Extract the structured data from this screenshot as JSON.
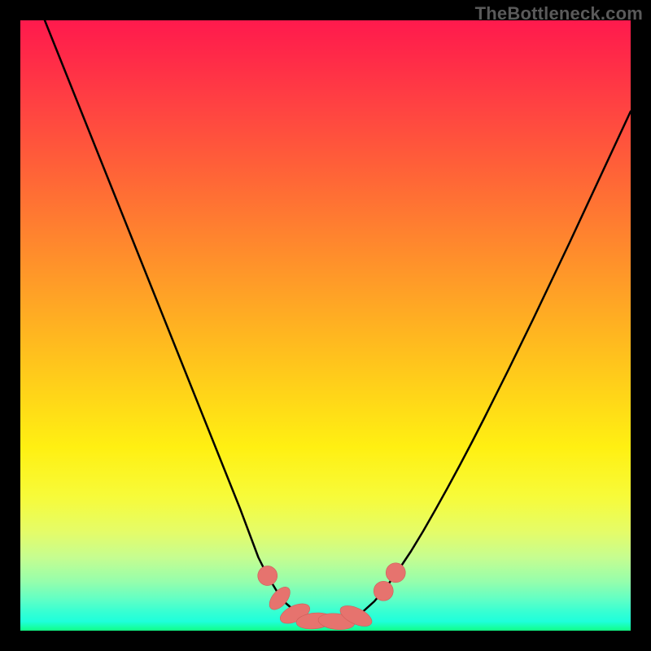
{
  "attribution": "TheBottleneck.com",
  "colors": {
    "curve_stroke": "#000000",
    "bead_fill": "#e6736e",
    "bead_stroke": "#cc5e59"
  },
  "chart_data": {
    "type": "line",
    "title": "",
    "xlabel": "",
    "ylabel": "",
    "xlim": [
      0,
      100
    ],
    "ylim": [
      0,
      100
    ],
    "grid": false,
    "legend": null,
    "series": [
      {
        "name": "curve",
        "x": [
          4,
          6,
          8,
          10,
          12,
          14,
          16,
          18,
          20,
          22,
          24,
          26,
          28,
          30,
          32,
          34,
          36,
          37.5,
          39,
          40.5,
          42,
          43.5,
          45,
          46.5,
          48,
          49.5,
          51,
          52.5,
          54,
          56,
          58,
          60,
          62,
          64,
          66,
          68,
          70,
          72,
          74,
          76,
          78,
          80,
          82,
          84,
          86,
          88,
          90,
          92,
          94,
          96,
          98,
          100
        ],
        "y": [
          100,
          95,
          90,
          85,
          80,
          75,
          70,
          65,
          60,
          55,
          50,
          45,
          40,
          35,
          30,
          25,
          20,
          16,
          12,
          9,
          6.5,
          4.5,
          3.2,
          2.3,
          1.7,
          1.4,
          1.3,
          1.5,
          1.9,
          3.0,
          4.8,
          7.2,
          10.0,
          13.0,
          16.3,
          19.8,
          23.4,
          27.1,
          30.9,
          34.8,
          38.8,
          42.8,
          46.9,
          51.0,
          55.2,
          59.4,
          63.6,
          67.9,
          72.2,
          76.5,
          80.8,
          85.1
        ]
      }
    ],
    "markers": [
      {
        "cx": 40.5,
        "cy": 9.0,
        "rx": 1.6,
        "ry": 1.6,
        "angle": -55
      },
      {
        "cx": 42.5,
        "cy": 5.3,
        "rx": 2.2,
        "ry": 1.2,
        "angle": -50
      },
      {
        "cx": 45.0,
        "cy": 2.8,
        "rx": 2.6,
        "ry": 1.3,
        "angle": -25
      },
      {
        "cx": 48.2,
        "cy": 1.6,
        "rx": 3.0,
        "ry": 1.3,
        "angle": -6
      },
      {
        "cx": 51.8,
        "cy": 1.5,
        "rx": 3.0,
        "ry": 1.3,
        "angle": 6
      },
      {
        "cx": 55.0,
        "cy": 2.4,
        "rx": 2.8,
        "ry": 1.3,
        "angle": 25
      },
      {
        "cx": 59.5,
        "cy": 6.5,
        "rx": 1.6,
        "ry": 1.6,
        "angle": 45
      },
      {
        "cx": 61.5,
        "cy": 9.5,
        "rx": 1.6,
        "ry": 1.6,
        "angle": 48
      }
    ]
  }
}
